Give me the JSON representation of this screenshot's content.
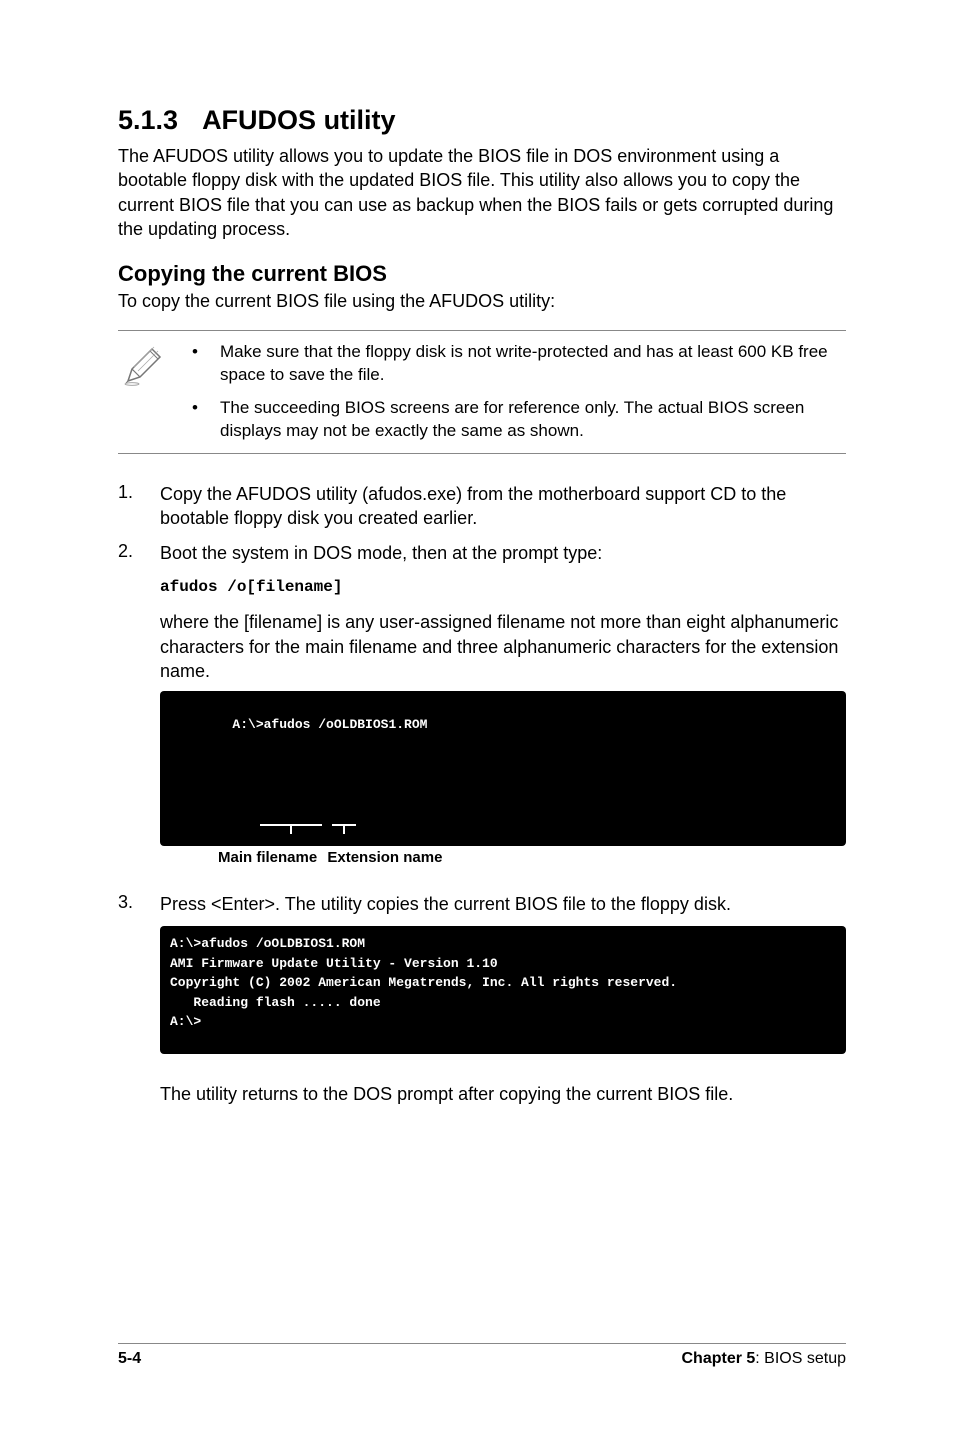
{
  "section": {
    "number": "5.1.3",
    "title": "AFUDOS utility"
  },
  "intro": "The AFUDOS utility allows you to update the BIOS file in DOS environment using a bootable floppy disk with the updated BIOS file. This utility also allows you to copy the current BIOS file that you can use as backup when the BIOS fails or gets corrupted during the updating process.",
  "subhead": "Copying the current BIOS",
  "subhead_desc": "To copy the current BIOS file using the AFUDOS utility:",
  "notes": {
    "items": [
      "Make sure that the floppy disk is not write-protected and has at least 600 KB free space to save the file.",
      "The succeeding BIOS screens are for reference only. The actual BIOS screen displays may not be exactly the same as shown."
    ]
  },
  "steps": {
    "s1": "Copy the AFUDOS utility (afudos.exe) from the motherboard support CD to the bootable floppy disk you created earlier.",
    "s2": "Boot the system in DOS mode, then at the prompt type:",
    "s2_cmd": "afudos /o[filename]",
    "s2_desc": "where the [filename] is any user-assigned filename not more than eight alphanumeric characters  for the main filename and three alphanumeric characters for the extension name.",
    "code1": "A:\\>afudos /oOLDBIOS1.ROM",
    "annot_main": "Main filename",
    "annot_ext": "Extension name",
    "s3": "Press <Enter>. The utility copies the current BIOS file to the floppy disk.",
    "code2": "A:\\>afudos /oOLDBIOS1.ROM\nAMI Firmware Update Utility - Version 1.10\nCopyright (C) 2002 American Megatrends, Inc. All rights reserved.\n   Reading flash ..... done\nA:\\>",
    "after": "The utility returns to the DOS prompt after copying the current BIOS file."
  },
  "footer": {
    "page": "5-4",
    "chapter_label": "Chapter 5",
    "chapter_title": ": BIOS setup"
  }
}
